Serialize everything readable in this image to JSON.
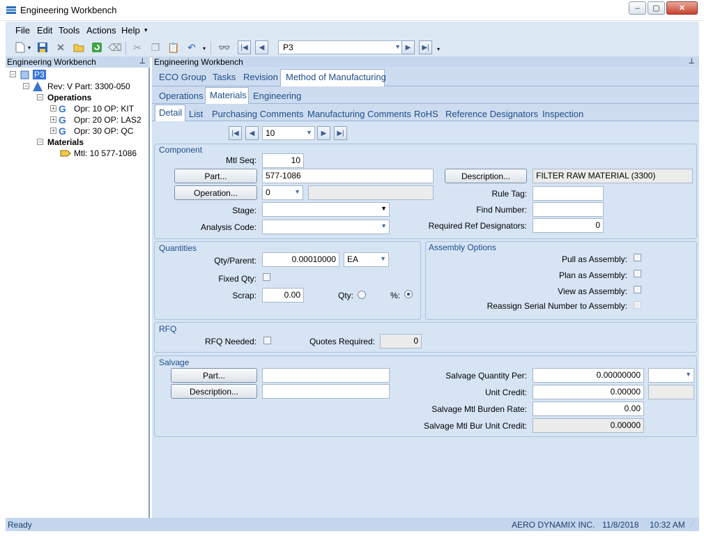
{
  "window": {
    "title": "Engineering Workbench",
    "min": "–",
    "max": "▢",
    "close": "✕"
  },
  "menu": [
    "File",
    "Edit",
    "Tools",
    "Actions",
    "Help"
  ],
  "toolbar": {
    "combo_value": "P3"
  },
  "left_pane": {
    "header": "Engineering Workbench",
    "tree": {
      "root": "P3",
      "rev": "Rev: V Part: 3300-050",
      "operations_label": "Operations",
      "operations": [
        "Opr: 10 OP: KIT",
        "Opr: 20 OP: LAS2",
        "Opr: 30 OP: QC"
      ],
      "materials_label": "Materials",
      "materials": [
        "Mtl: 10 577-1086"
      ]
    }
  },
  "right_pane": {
    "header": "Engineering Workbench",
    "tabs1": [
      "ECO Group",
      "Tasks",
      "Revision",
      "Method of Manufacturing"
    ],
    "tabs2": [
      "Operations",
      "Materials",
      "Engineering"
    ],
    "tabs3": [
      "Detail",
      "List",
      "Purchasing Comments",
      "Manufacturing Comments",
      "RoHS",
      "Reference Designators",
      "Inspection"
    ],
    "record_nav_value": "10"
  },
  "component": {
    "title": "Component",
    "mtl_seq_label": "Mtl Seq:",
    "mtl_seq": "10",
    "part_btn": "Part...",
    "part_value": "577-1086",
    "desc_btn": "Description...",
    "desc_value": "FILTER RAW MATERIAL (3300)",
    "operation_btn": "Operation...",
    "operation_value": "0",
    "rule_tag_label": "Rule Tag:",
    "stage_label": "Stage:",
    "find_number_label": "Find Number:",
    "analysis_code_label": "Analysis Code:",
    "req_ref_label": "Required Ref Designators:",
    "req_ref_value": "0"
  },
  "quantities": {
    "title": "Quantities",
    "qty_parent_label": "Qty/Parent:",
    "qty_parent": "0.00010000",
    "uom": "EA",
    "fixed_qty_label": "Fixed Qty:",
    "scrap_label": "Scrap:",
    "scrap": "0.00",
    "qty_radio_label": "Qty:",
    "pct_radio_label": "%:"
  },
  "assembly": {
    "title": "Assembly Options",
    "pull": "Pull as Assembly:",
    "plan": "Plan as Assembly:",
    "view": "View as Assembly:",
    "reassign": "Reassign Serial Number to Assembly:"
  },
  "rfq": {
    "title": "RFQ",
    "needed_label": "RFQ Needed:",
    "quotes_label": "Quotes Required:",
    "quotes_value": "0"
  },
  "salvage": {
    "title": "Salvage",
    "part_btn": "Part...",
    "desc_btn": "Description...",
    "qty_per_label": "Salvage Quantity Per:",
    "qty_per": "0.00000000",
    "unit_credit_label": "Unit Credit:",
    "unit_credit": "0.00000",
    "burden_label": "Salvage Mtl Burden Rate:",
    "burden": "0.00",
    "bur_unit_label": "Salvage Mtl Bur Unit Credit:",
    "bur_unit": "0.00000"
  },
  "status": {
    "left": "Ready",
    "company": "AERO DYNAMIX INC.",
    "date": "11/8/2018",
    "time": "10:32 AM"
  }
}
